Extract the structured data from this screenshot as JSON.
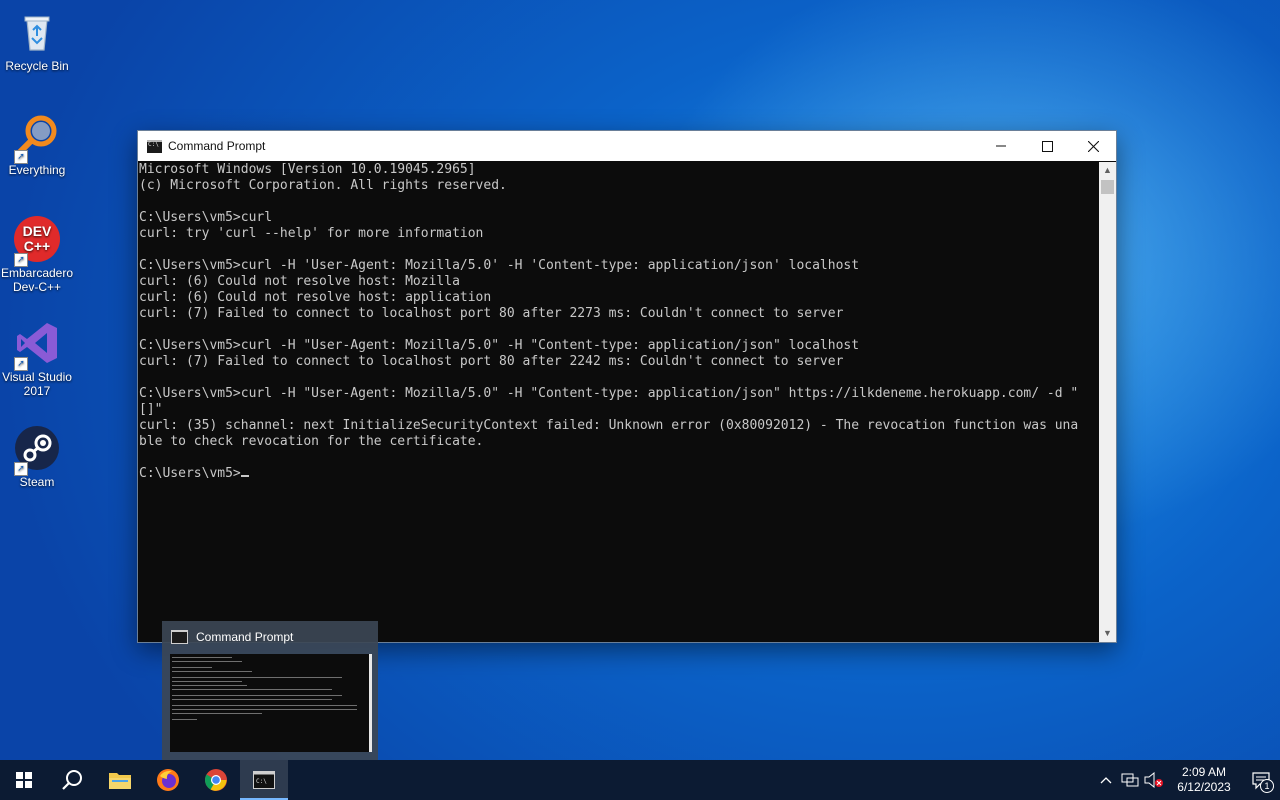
{
  "desktop_icons": [
    {
      "label": "Recycle Bin",
      "icon": "recycle-bin-icon"
    },
    {
      "label": "Everything",
      "icon": "everything-search-icon"
    },
    {
      "label": "Embarcadero Dev-C++",
      "icon": "devcpp-icon"
    },
    {
      "label": "Visual Studio 2017",
      "icon": "visual-studio-icon"
    },
    {
      "label": "Steam",
      "icon": "steam-icon"
    }
  ],
  "window": {
    "title": "Command Prompt",
    "console_lines": [
      "Microsoft Windows [Version 10.0.19045.2965]",
      "(c) Microsoft Corporation. All rights reserved.",
      "",
      "C:\\Users\\vm5>curl",
      "curl: try 'curl --help' for more information",
      "",
      "C:\\Users\\vm5>curl -H 'User-Agent: Mozilla/5.0' -H 'Content-type: application/json' localhost",
      "curl: (6) Could not resolve host: Mozilla",
      "curl: (6) Could not resolve host: application",
      "curl: (7) Failed to connect to localhost port 80 after 2273 ms: Couldn't connect to server",
      "",
      "C:\\Users\\vm5>curl -H \"User-Agent: Mozilla/5.0\" -H \"Content-type: application/json\" localhost",
      "curl: (7) Failed to connect to localhost port 80 after 2242 ms: Couldn't connect to server",
      "",
      "C:\\Users\\vm5>curl -H \"User-Agent: Mozilla/5.0\" -H \"Content-type: application/json\" https://ilkdeneme.herokuapp.com/ -d \"",
      "[]\"",
      "curl: (35) schannel: next InitializeSecurityContext failed: Unknown error (0x80092012) - The revocation function was una",
      "ble to check revocation for the certificate.",
      ""
    ],
    "prompt": "C:\\Users\\vm5>"
  },
  "preview": {
    "title": "Command Prompt"
  },
  "taskbar": {
    "apps": [
      "windows-start-icon",
      "search-icon",
      "file-explorer-icon",
      "firefox-icon",
      "chrome-icon",
      "command-prompt-icon"
    ],
    "time": "2:09 AM",
    "date": "6/12/2023",
    "notification_count": "1"
  },
  "colors": {
    "console_bg": "#0c0c0c",
    "console_fg": "#c8c8c8",
    "taskbar_bg": "#0c1b33",
    "desktop_blue": "#0b63c9"
  }
}
